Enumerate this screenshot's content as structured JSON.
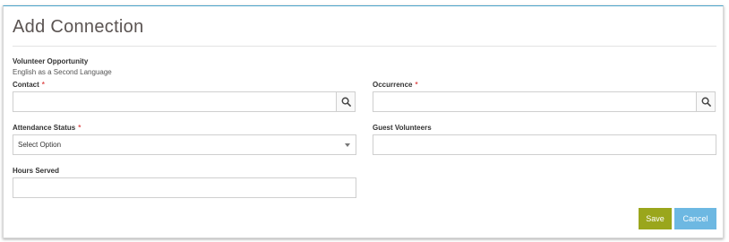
{
  "dialog": {
    "title": "Add Connection"
  },
  "volunteer_opportunity": {
    "label": "Volunteer Opportunity",
    "value": "English as a Second Language"
  },
  "fields": {
    "contact": {
      "label": "Contact",
      "required_mark": "*",
      "value": ""
    },
    "occurrence": {
      "label": "Occurrence",
      "required_mark": "*",
      "value": ""
    },
    "attendance_status": {
      "label": "Attendance Status",
      "required_mark": "*",
      "selected": "Select Option"
    },
    "guest_volunteers": {
      "label": "Guest Volunteers",
      "value": ""
    },
    "hours_served": {
      "label": "Hours Served",
      "value": ""
    }
  },
  "buttons": {
    "save_label": "Save",
    "cancel_label": "Cancel"
  },
  "icons": {
    "contact_lookup": "search-icon",
    "occurrence_lookup": "search-icon",
    "status_dropdown": "chevron-down-icon"
  },
  "colors": {
    "header_rule": "#4aa3c9",
    "required": "#e05252",
    "save_button": "#9aa61c",
    "cancel_button": "#6db8e2"
  }
}
